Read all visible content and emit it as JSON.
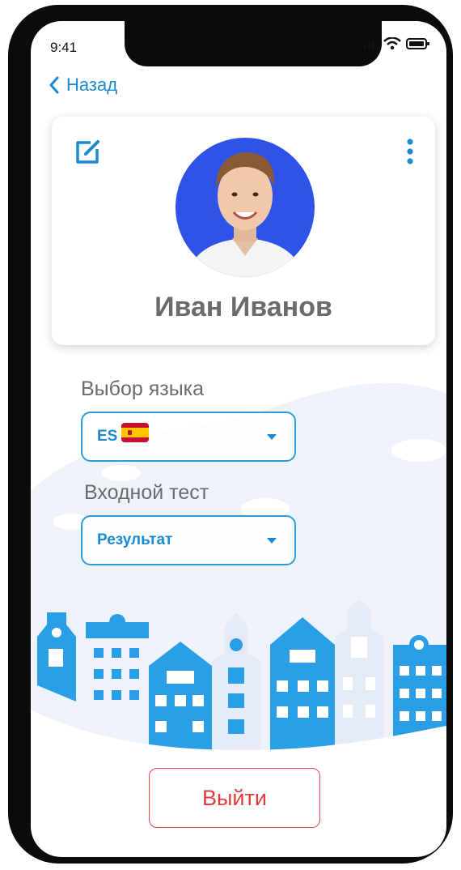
{
  "status_bar": {
    "time": "9:41",
    "signal_icon": "signal-icon",
    "wifi_icon": "wifi-icon",
    "battery_icon": "battery-icon"
  },
  "nav": {
    "back_label": "Назад",
    "back_icon": "chevron-left-icon"
  },
  "profile": {
    "name": "Иван Иванов",
    "edit_icon": "edit-icon",
    "more_icon": "more-vertical-icon",
    "avatar_bg": "#2f53e8"
  },
  "language": {
    "label": "Выбор языка",
    "selected": "ES",
    "flag_icon": "spain-flag-icon"
  },
  "entry_test": {
    "label": "Входной тест",
    "selected": "Результат"
  },
  "logout": {
    "label": "Выйти"
  },
  "colors": {
    "accent": "#1a8ad4",
    "danger": "#e03a3a",
    "text_muted": "#6b6b6b"
  }
}
